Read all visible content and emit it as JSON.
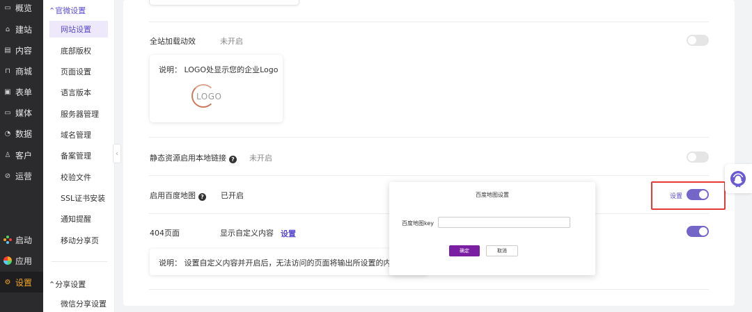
{
  "nav": {
    "items": [
      {
        "icon": "overview-icon",
        "label": "概览"
      },
      {
        "icon": "build-icon",
        "label": "建站"
      },
      {
        "icon": "content-icon",
        "label": "内容"
      },
      {
        "icon": "shop-icon",
        "label": "商城"
      },
      {
        "icon": "form-icon",
        "label": "表单"
      },
      {
        "icon": "media-icon",
        "label": "媒体"
      },
      {
        "icon": "data-icon",
        "label": "数据"
      },
      {
        "icon": "customer-icon",
        "label": "客户"
      },
      {
        "icon": "operation-icon",
        "label": "运营"
      }
    ],
    "bottom": [
      {
        "icon": "launch-icon",
        "label": "启动"
      },
      {
        "icon": "apps-icon",
        "label": "应用"
      },
      {
        "icon": "settings-icon",
        "label": "设置"
      }
    ]
  },
  "submenu": {
    "group1": "官微设置",
    "items": [
      "网站设置",
      "底部版权",
      "页面设置",
      "语言版本",
      "服务器管理",
      "域名管理",
      "备案管理",
      "校验文件",
      "SSL证书安装",
      "通知提醒",
      "移动分享页"
    ],
    "group2": "分享设置",
    "group2_items": [
      "微信分享设置"
    ]
  },
  "rows": {
    "animation": {
      "label": "全站加载动效",
      "status": "未开启"
    },
    "logo_note": {
      "text": "说明：   LOGO处显示您的企业Logo",
      "logo_text": "LOGO"
    },
    "static": {
      "label": "静态资源启用本地链接",
      "status": "未开启"
    },
    "baidu_map": {
      "label": "启用百度地图",
      "status": "已开启",
      "setting_link": "设置"
    },
    "page404": {
      "label": "404页面",
      "status": "显示自定义内容",
      "setting_link": "设置",
      "note": "说明：   设置自定义内容并开启后，无法访问的页面将输出所设置的内容"
    }
  },
  "modal": {
    "title": "百度地图设置",
    "field_label": "百度地图key",
    "field_value": "",
    "ok": "确定",
    "cancel": "取消"
  },
  "colors": {
    "accent": "#5a4bd1",
    "toggle_on": "#7466c9",
    "highlight": "#e53935",
    "nav_bg": "#2b2b2e"
  }
}
